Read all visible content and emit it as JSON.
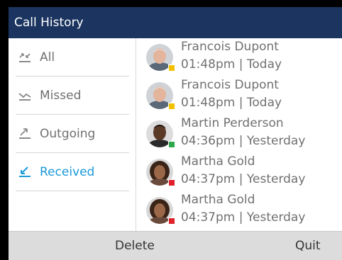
{
  "window": {
    "title": "Call History"
  },
  "filters": [
    {
      "label": "All",
      "icon": "all-calls-icon"
    },
    {
      "label": "Missed",
      "icon": "missed-call-icon"
    },
    {
      "label": "Outgoing",
      "icon": "outgoing-call-icon"
    },
    {
      "label": "Received",
      "icon": "received-call-icon",
      "selected": true
    }
  ],
  "calls": [
    {
      "name": "Francois Dupont",
      "time": "01:48pm | Today",
      "status_color": "#f2c200",
      "avatar": "older-man-avatar"
    },
    {
      "name": "Francois Dupont",
      "time": "01:48pm | Today",
      "status_color": "#f2c200",
      "avatar": "older-man-avatar"
    },
    {
      "name": "Martin Perderson",
      "time": "04:36pm | Yesterday",
      "status_color": "#2ea84a",
      "avatar": "man-avatar"
    },
    {
      "name": "Martha Gold",
      "time": "04:37pm | Yesterday",
      "status_color": "#e0202a",
      "avatar": "woman-avatar"
    },
    {
      "name": "Martha Gold",
      "time": "04:37pm | Yesterday",
      "status_color": "#e0202a",
      "avatar": "woman-avatar"
    }
  ],
  "softkeys": {
    "left": "Delete",
    "right": "Quit"
  },
  "colors": {
    "titlebar": "#1b3560",
    "selected": "#1a9ad8",
    "text": "#707070"
  }
}
